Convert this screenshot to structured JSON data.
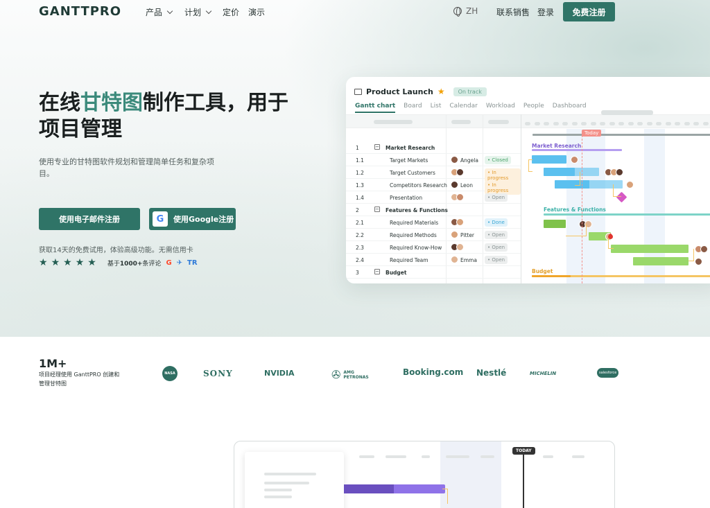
{
  "nav": {
    "logo": "GANTTPRO",
    "items": [
      {
        "label": "产品",
        "dropdown": true
      },
      {
        "label": "计划",
        "dropdown": true
      },
      {
        "label": "定价",
        "dropdown": false
      },
      {
        "label": "演示",
        "dropdown": false
      }
    ],
    "language": "ZH",
    "contact_sales": "联系销售",
    "login": "登录",
    "signup": "免费注册"
  },
  "hero": {
    "title_part1": "在线",
    "title_accent": "甘特图",
    "title_part2": "制作工具，用于项目管理",
    "subtitle": "使用专业的甘特图软件规划和管理简单任务和复杂项目。",
    "btn_email": "使用电子邮件注册",
    "btn_google": "使用Google注册",
    "google_letter": "G",
    "trial_note": "获取14天的免费试用，体验高级功能。无需信用卡",
    "stars": 5,
    "reviews_prefix": "基于",
    "reviews_count": "1000+",
    "reviews_suffix": "条评论",
    "review_sites": [
      "G",
      "✈",
      "TR"
    ]
  },
  "gantt": {
    "project": "Product Launch",
    "status": "On track",
    "tabs": [
      "Gantt chart",
      "Board",
      "List",
      "Calendar",
      "Workload",
      "People",
      "Dashboard"
    ],
    "active_tab": "Gantt chart",
    "today_label": "Today",
    "rows": [
      {
        "num": "1",
        "name": "Market Research",
        "group": true
      },
      {
        "num": "1.1",
        "name": "Target Markets",
        "who": "Angela",
        "status": "Closed",
        "st": "closed"
      },
      {
        "num": "1.2",
        "name": "Target Customers",
        "who": "",
        "status": "In progress",
        "st": "prog"
      },
      {
        "num": "1.3",
        "name": "Competitors Research",
        "who": "Leon",
        "status": "In progress",
        "st": "prog"
      },
      {
        "num": "1.4",
        "name": "Presentation",
        "who": "",
        "status": "Open",
        "st": "open"
      },
      {
        "num": "2",
        "name": "Features & Functions",
        "group": true
      },
      {
        "num": "2.1",
        "name": "Required Materials",
        "who": "",
        "status": "Done",
        "st": "done"
      },
      {
        "num": "2.2",
        "name": "Required Methods",
        "who": "Pitter",
        "status": "Open",
        "st": "open"
      },
      {
        "num": "2.3",
        "name": "Required Know-How",
        "who": "",
        "status": "Open",
        "st": "open"
      },
      {
        "num": "2.4",
        "name": "Required Team",
        "who": "Emma",
        "status": "Open",
        "st": "open"
      },
      {
        "num": "3",
        "name": "Budget",
        "group": true
      }
    ],
    "chart_groups": [
      "Market Research",
      "Features & Functions",
      "Budget"
    ]
  },
  "social": {
    "count": "1M+",
    "caption": "项目经理使用 GanttPRO 创建和管理甘特图",
    "brands": [
      "NASA",
      "SONY",
      "NVIDIA",
      "AMG PETRONAS",
      "Booking.com",
      "Nestlé",
      "MICHELIN",
      "salesforce"
    ]
  },
  "demo": {
    "today_label": "TODAY"
  },
  "colors": {
    "brand": "#2f7467",
    "accent": "#3b8a7b",
    "market_bar": "#5bc0ef",
    "features_bar": "#9ad86a",
    "budget_bar": "#f5c563",
    "milestone": "#d659c4"
  }
}
